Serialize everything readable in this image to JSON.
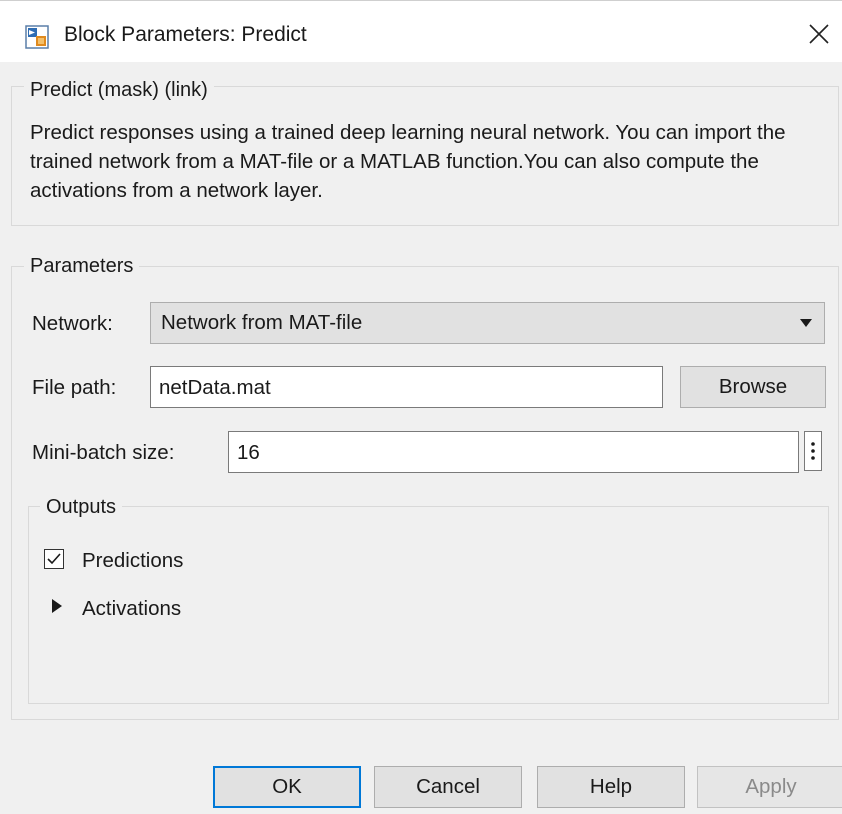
{
  "window": {
    "title": "Block Parameters: Predict",
    "icon": "simulink-block-icon",
    "close_icon": "close-icon"
  },
  "description_group": {
    "legend": "Predict (mask) (link)",
    "text": "Predict responses using a trained deep learning neural network. You can import the trained network from a MAT-file or a MATLAB function.You can also compute the activations from a network layer."
  },
  "parameters": {
    "legend": "Parameters",
    "network_label": "Network:",
    "network_value": "Network from MAT-file",
    "file_path_label": "File path:",
    "file_path_value": "netData.mat",
    "browse_label": "Browse",
    "minibatch_label": "Mini-batch size:",
    "minibatch_value": "16",
    "outputs": {
      "legend": "Outputs",
      "predictions_label": "Predictions",
      "predictions_checked": true,
      "activations_label": "Activations",
      "activations_expanded": false
    }
  },
  "footer": {
    "ok_label": "OK",
    "cancel_label": "Cancel",
    "help_label": "Help",
    "apply_label": "Apply"
  },
  "colors": {
    "accent": "#0078d7",
    "dialog_bg": "#f0f0f0",
    "button_bg": "#e1e1e1"
  }
}
